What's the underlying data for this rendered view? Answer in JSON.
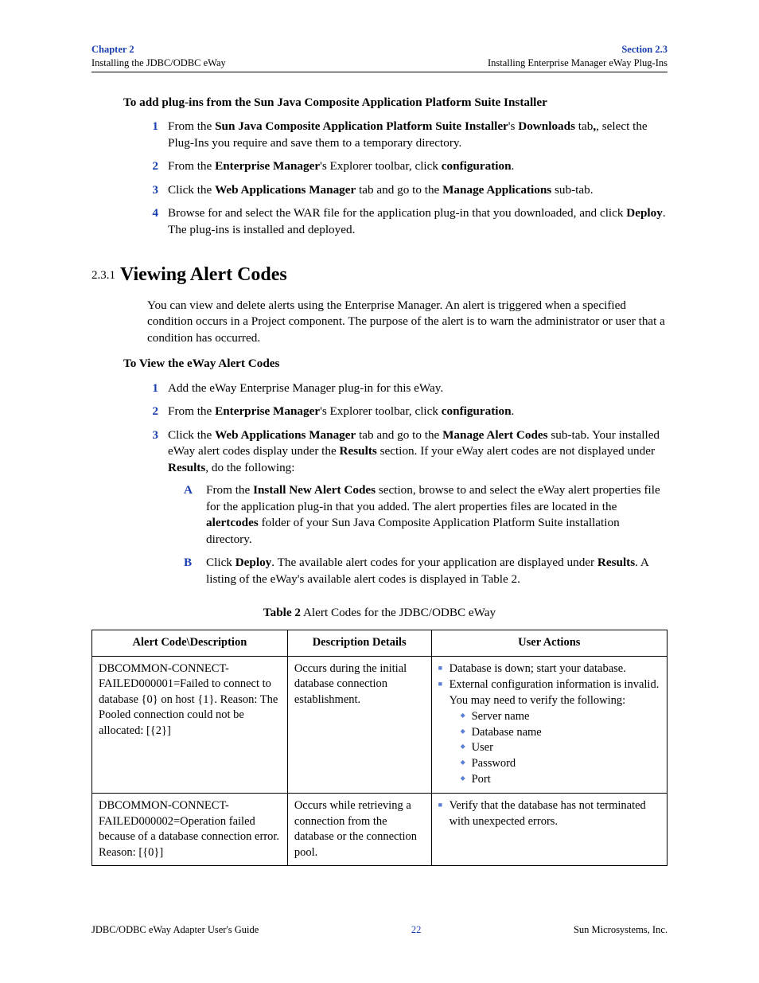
{
  "header": {
    "left_top": "Chapter 2",
    "left_sub": "Installing the JDBC/ODBC eWay",
    "right_top": "Section 2.3",
    "right_sub": "Installing Enterprise Manager eWay Plug-Ins"
  },
  "intro1": "To add plug-ins from the Sun Java Composite Application Platform Suite Installer",
  "steps1": {
    "s1a": "From the ",
    "s1b": "Sun Java Composite Application Platform Suite Installer",
    "s1c": "'s ",
    "s1d": "Downloads",
    "s1e": " tab",
    "s1f": ", select the Plug-Ins you require and save them to a temporary directory.",
    "s2a": "From the ",
    "s2b": "Enterprise Manager",
    "s2c": "'s Explorer toolbar, click ",
    "s2d": "configuration",
    "s2e": ".",
    "s3a": "Click the ",
    "s3b": "Web Applications Manager",
    "s3c": " tab and go to the ",
    "s3d": "Manage Applications",
    "s3e": " sub-tab.",
    "s4a": "Browse for and select the WAR file for the application plug-in that you downloaded, and click ",
    "s4b": "Deploy",
    "s4c": ". The plug-ins is installed and deployed."
  },
  "section": {
    "num": "2.3.1",
    "title": "Viewing Alert Codes",
    "para": "You can view and delete alerts using the Enterprise Manager. An alert is triggered when a specified condition occurs in a Project component. The purpose of the alert is to warn the administrator or user that a condition has occurred."
  },
  "intro2": "To View the eWay Alert Codes",
  "steps2": {
    "s1": "Add the eWay Enterprise Manager plug-in for this eWay.",
    "s2a": "From the ",
    "s2b": "Enterprise Manager",
    "s2c": "'s Explorer toolbar, click ",
    "s2d": "configuration",
    "s2e": ".",
    "s3a": "Click the ",
    "s3b": "Web Applications Manager",
    "s3c": " tab and go to the ",
    "s3d": "Manage Alert Codes",
    "s3e": " sub-tab. Your installed eWay alert codes display under the ",
    "s3f": "Results",
    "s3g": " section. If your eWay alert codes are not displayed under ",
    "s3h": "Results",
    "s3i": ", do the following:",
    "Aa": "From the ",
    "Ab": "Install New Alert Codes",
    "Ac": " section, browse to and select the eWay alert properties file for the application plug-in that you added. The alert properties files are located in the ",
    "Ad": "alertcodes",
    "Ae": " folder of your Sun Java Composite Application Platform Suite installation directory.",
    "Ba": "Click ",
    "Bb": "Deploy",
    "Bc": ". The available alert codes for your application are displayed under ",
    "Bd": "Results",
    "Be": ". A listing of the eWay's available alert codes is displayed in Table 2."
  },
  "table": {
    "caption_label": "Table 2",
    "caption_text": "   Alert Codes for the JDBC/ODBC eWay",
    "h1": "Alert Code\\Description",
    "h2": "Description Details",
    "h3": "User Actions",
    "r1c1": "DBCOMMON-CONNECT-FAILED000001=Failed to connect to database {0} on host {1}. Reason: The Pooled connection could not be allocated: [{2}]",
    "r1c2": "Occurs during the initial database connection establishment.",
    "r1c3_b1": "Database is down; start your database.",
    "r1c3_b2": "External configuration information is invalid. You may need to verify the following:",
    "r1c3_d1": "Server name",
    "r1c3_d2": "Database name",
    "r1c3_d3": "User",
    "r1c3_d4": "Password",
    "r1c3_d5": "Port",
    "r2c1": "DBCOMMON-CONNECT-FAILED000002=Operation failed because of a database connection error. Reason: [{0}]",
    "r2c2": "Occurs while retrieving a connection from the database or the connection pool.",
    "r2c3_b1": "Verify that the database has not terminated with unexpected errors."
  },
  "footer": {
    "left": "JDBC/ODBC eWay Adapter User's Guide",
    "page": "22",
    "right": "Sun Microsystems, Inc."
  }
}
